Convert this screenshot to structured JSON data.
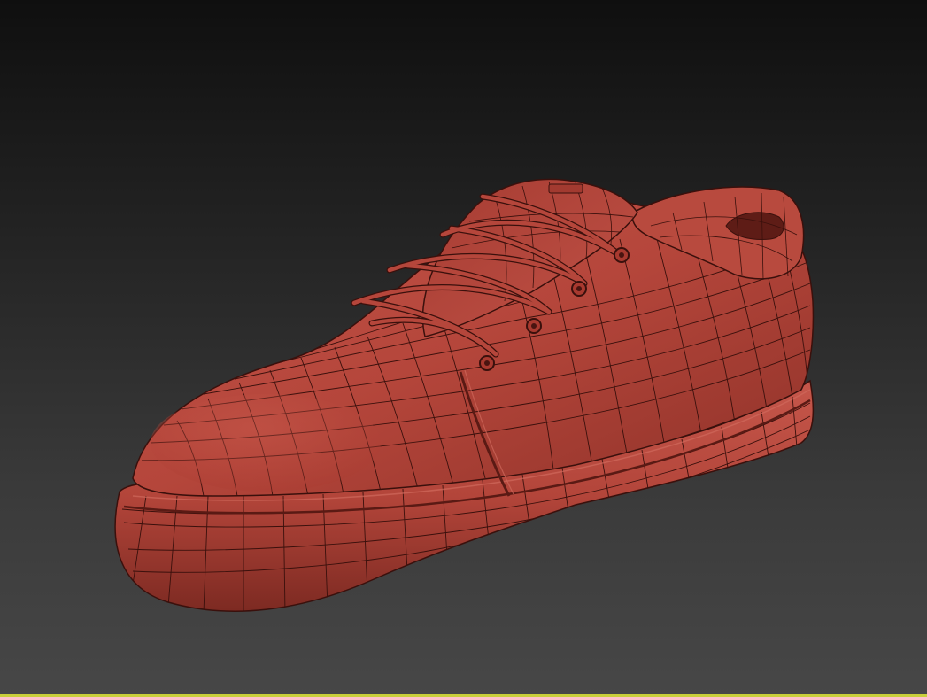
{
  "viewport": {
    "background_top": "#0f0f0f",
    "background_bottom": "#474747",
    "active_border_color": "#c9cf3a"
  },
  "model": {
    "object": "shoe-mesh",
    "shading": "smooth-with-wireframe",
    "base_color": "#b9493c",
    "highlight_color": "#d8685a",
    "shadow_color": "#7a2720",
    "edge_color": "#3a100c"
  }
}
